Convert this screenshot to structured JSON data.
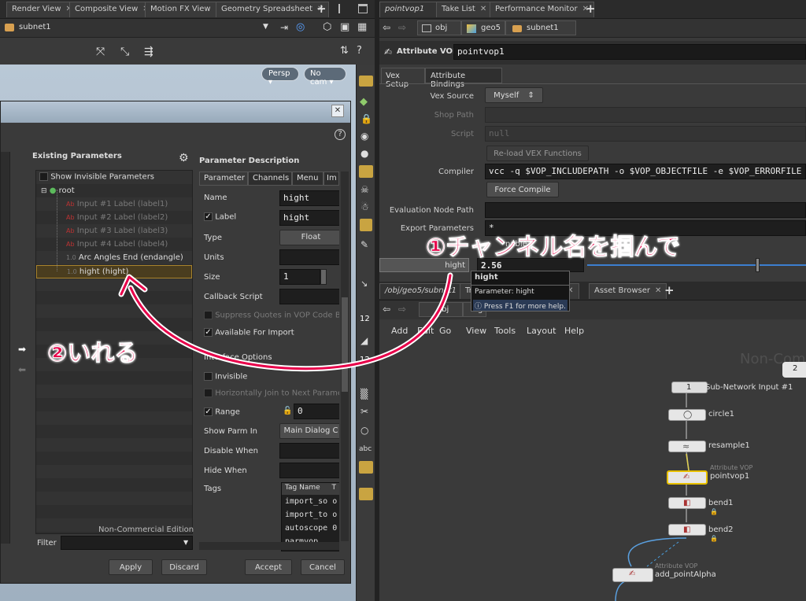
{
  "left_tabs": [
    "Render View",
    "Composite View",
    "Motion FX View",
    "Geometry Spreadsheet"
  ],
  "left_path": "subnet1",
  "viewport": {
    "persp": "Persp",
    "cam": "No cam"
  },
  "dialog": {
    "existing_params_title": "Existing Parameters",
    "show_invisible": "Show Invisible Parameters",
    "tree_root": "root",
    "tree_items": [
      "Input #1 Label (label1)",
      "Input #2 Label (label2)",
      "Input #3 Label (label3)",
      "Input #4 Label (label4)",
      "Arc Angles End (endangle)",
      "hight (hight)"
    ],
    "watermark": "Non-Commercial Edition",
    "filter_label": "Filter",
    "param_desc_title": "Parameter Description",
    "tabs": [
      "Parameter",
      "Channels",
      "Menu",
      "Im"
    ],
    "name_label": "Name",
    "name_value": "hight",
    "label_label": "Label",
    "label_value": "hight",
    "type_label": "Type",
    "type_value": "Float",
    "units_label": "Units",
    "size_label": "Size",
    "size_value": "1",
    "callback_label": "Callback Script",
    "suppress_label": "Suppress Quotes in VOP Code Blo",
    "available_label": "Available For Import",
    "interface_label": "Interface Options",
    "invisible_label": "Invisible",
    "hjoin_label": "Horizontally Join to Next Parame",
    "range_label": "Range",
    "range_value": "0",
    "showparm_label": "Show Parm In",
    "showparm_value": "Main Dialog C",
    "disable_label": "Disable When",
    "hide_label": "Hide When",
    "tags_label": "Tags",
    "tag_headers": [
      "Tag Name",
      "T"
    ],
    "tag_rows": [
      "import_so",
      "import_to",
      "autoscope",
      "parmvop"
    ],
    "tag_vals": [
      "o",
      "o",
      "0",
      ""
    ],
    "buttons": {
      "apply": "Apply",
      "discard": "Discard",
      "accept": "Accept",
      "cancel": "Cancel"
    }
  },
  "right_tabs": [
    "pointvop1",
    "Take List",
    "Performance Monitor"
  ],
  "right_path": [
    "obj",
    "geo5",
    "subnet1"
  ],
  "node_header": {
    "type": "Attribute VOP",
    "name": "pointvop1"
  },
  "param_tabs": [
    "Vex Setup",
    "Attribute Bindings"
  ],
  "params": {
    "vex_source_label": "Vex Source",
    "vex_source_value": "Myself",
    "shop_path_label": "Shop Path",
    "script_label": "Script",
    "script_value": "null",
    "reload_btn": "Re-load VEX Functions",
    "compiler_label": "Compiler",
    "compiler_value": "vcc -q $VOP_INCLUDEPATH -o $VOP_OBJECTFILE -e $VOP_ERRORFILE $",
    "force_btn": "Force Compile",
    "eval_label": "Evaluation Node Path",
    "export_label": "Export Parameters",
    "export_value": "*",
    "enable_label": "nable",
    "hight_label": "hight",
    "hight_value": "2.56"
  },
  "tooltip": {
    "title": "hight",
    "param": "Parameter: hight",
    "help": "Press F1 for more help."
  },
  "net_tabs": [
    "/obj/geo5/subnet1",
    "Tr",
    "e",
    "Asset Browser"
  ],
  "net_path": [
    "obj",
    "g"
  ],
  "net_menu": [
    "Add",
    "Edit",
    "Go",
    "View",
    "Tools",
    "Layout",
    "Help"
  ],
  "net_watermark": "Non-Comme",
  "nodes": [
    {
      "label": "Sub-Network Input #1",
      "badge": "1"
    },
    {
      "label": "circle1"
    },
    {
      "label": "resample1"
    },
    {
      "label": "pointvop1",
      "type": "Attribute VOP"
    },
    {
      "label": "bend1"
    },
    {
      "label": "bend2"
    },
    {
      "label": "add_pointAlpha",
      "type": "Attribute VOP"
    }
  ],
  "badge2": "2",
  "annotations": {
    "one": "①チャンネル名を掴んで",
    "two": "②いれる"
  },
  "colors": {
    "annotation": "#e8004a",
    "selected": "#e8c000"
  }
}
